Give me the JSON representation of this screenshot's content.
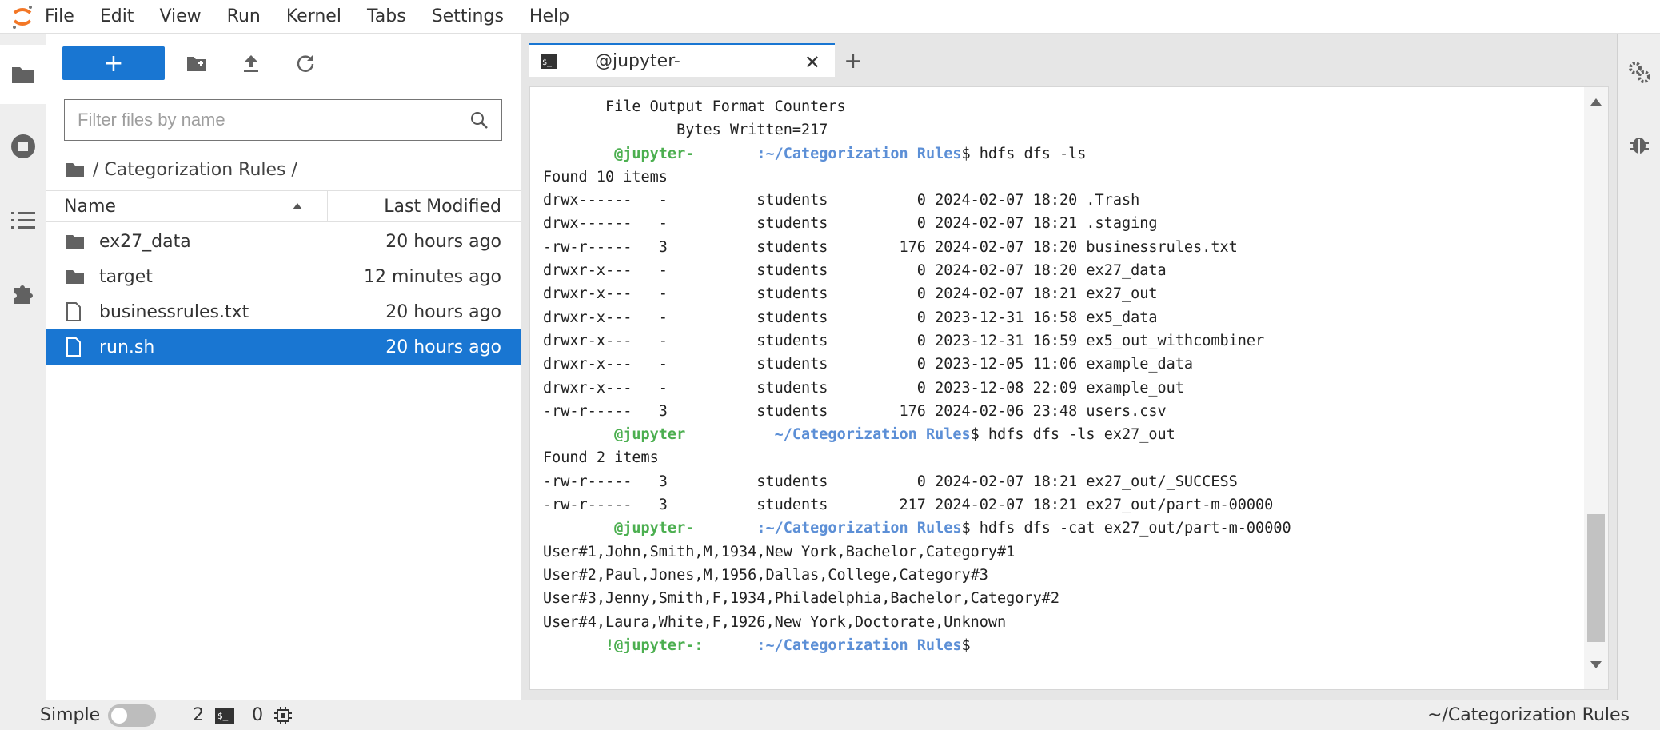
{
  "menubar": {
    "items": [
      "File",
      "Edit",
      "View",
      "Run",
      "Kernel",
      "Tabs",
      "Settings",
      "Help"
    ]
  },
  "filebrowser": {
    "new_label": "+",
    "search_placeholder": "Filter files by name",
    "breadcrumb": "/ Categorization Rules /",
    "columns": {
      "name": "Name",
      "modified": "Last Modified"
    },
    "files": [
      {
        "name": "ex27_data",
        "modified": "20 hours ago",
        "type": "folder"
      },
      {
        "name": "target",
        "modified": "12 minutes ago",
        "type": "folder"
      },
      {
        "name": "businessrules.txt",
        "modified": "20 hours ago",
        "type": "file"
      },
      {
        "name": "run.sh",
        "modified": "20 hours ago",
        "type": "file"
      }
    ]
  },
  "terminal": {
    "tab_title": "@jupyter-",
    "tab_add": "+",
    "lines": [
      "       File Output Format Counters",
      "               Bytes Written=217",
      "PROMPT1|        @jupyter-|       :~/Categorization Rules|$ hdfs dfs -ls",
      "Found 10 items",
      "drwx------   -          students          0 2024-02-07 18:20 .Trash",
      "drwx------   -          students          0 2024-02-07 18:21 .staging",
      "-rw-r-----   3          students        176 2024-02-07 18:20 businessrules.txt",
      "drwxr-x---   -          students          0 2024-02-07 18:20 ex27_data",
      "drwxr-x---   -          students          0 2024-02-07 18:21 ex27_out",
      "drwxr-x---   -          students          0 2023-12-31 16:58 ex5_data",
      "drwxr-x---   -          students          0 2023-12-31 16:59 ex5_out_withcombiner",
      "drwxr-x---   -          students          0 2023-12-05 11:06 example_data",
      "drwxr-x---   -          students          0 2023-12-08 22:09 example_out",
      "-rw-r-----   3          students        176 2024-02-06 23:48 users.csv",
      "PROMPT1|        @jupyter|          ~/Categorization Rules|$ hdfs dfs -ls ex27_out",
      "Found 2 items",
      "-rw-r-----   3          students          0 2024-02-07 18:21 ex27_out/_SUCCESS",
      "-rw-r-----   3          students        217 2024-02-07 18:21 ex27_out/part-m-00000",
      "PROMPT1|        @jupyter-|       :~/Categorization Rules|$ hdfs dfs -cat ex27_out/part-m-00000",
      "User#1,John,Smith,M,1934,New York,Bachelor,Category#1",
      "User#2,Paul,Jones,M,1956,Dallas,College,Category#3",
      "User#3,Jenny,Smith,F,1934,Philadelphia,Bachelor,Category#2",
      "User#4,Laura,White,F,1926,New York,Doctorate,Unknown",
      "PROMPT1|       !@jupyter-:|      :~/Categorization Rules|$ "
    ]
  },
  "statusbar": {
    "mode_label": "Simple",
    "terminals_count": "2",
    "kernels_count": "0",
    "path": "~/Categorization Rules"
  },
  "colors": {
    "accent": "#1976d2",
    "prompt_user": "#4caf50",
    "prompt_path": "#5c8fd6"
  }
}
